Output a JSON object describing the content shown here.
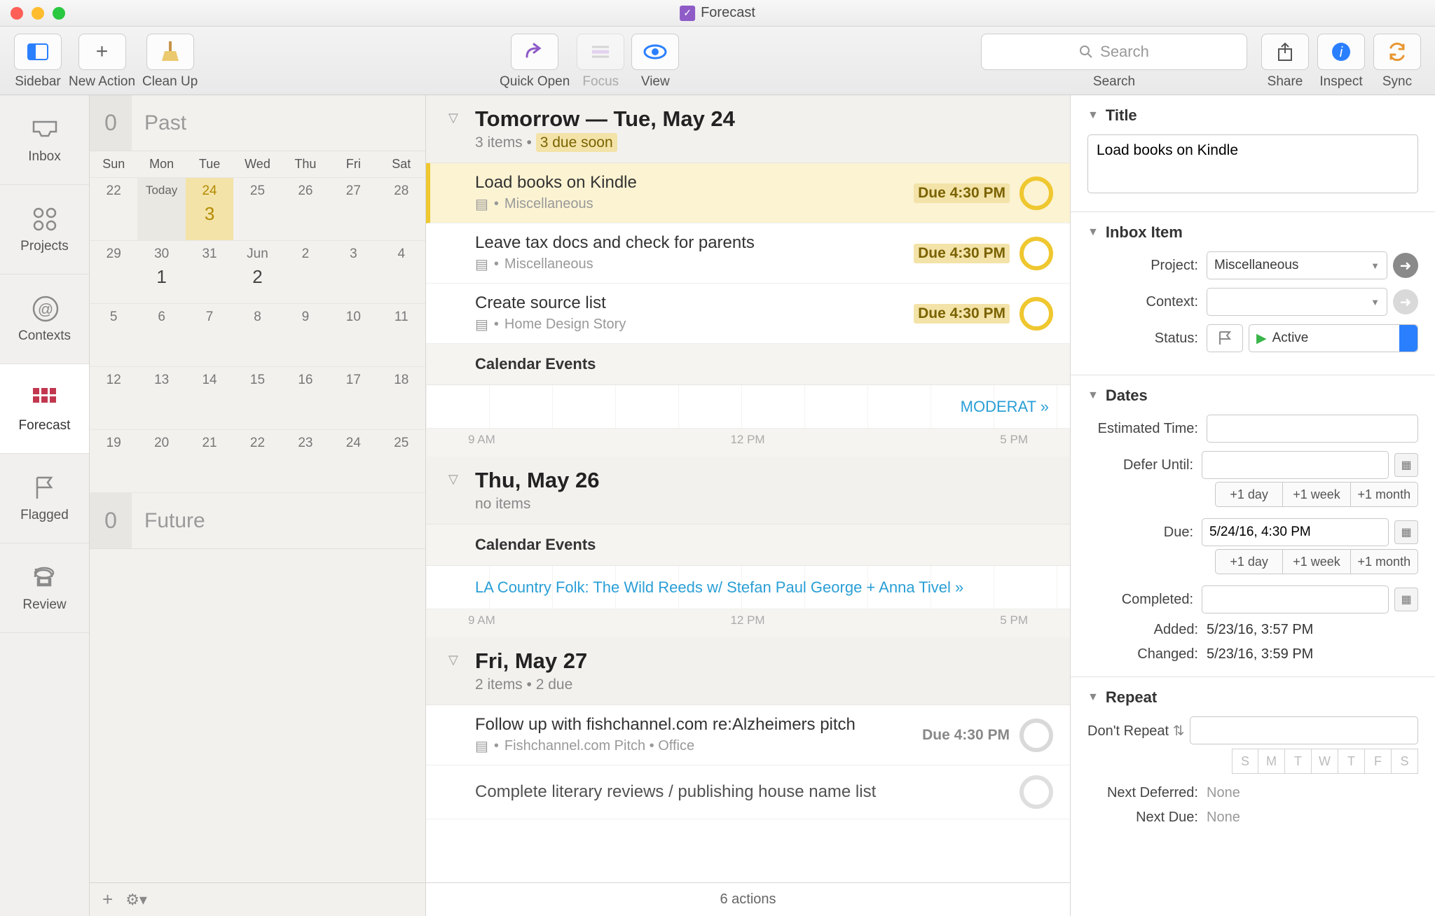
{
  "window": {
    "title": "Forecast"
  },
  "toolbar": {
    "sidebar": "Sidebar",
    "new_action": "New Action",
    "clean_up": "Clean Up",
    "quick_open": "Quick Open",
    "focus": "Focus",
    "view": "View",
    "search_placeholder": "Search",
    "search_label": "Search",
    "share": "Share",
    "inspect": "Inspect",
    "sync": "Sync"
  },
  "sidebar": {
    "items": [
      {
        "label": "Inbox"
      },
      {
        "label": "Projects"
      },
      {
        "label": "Contexts"
      },
      {
        "label": "Forecast"
      },
      {
        "label": "Flagged"
      },
      {
        "label": "Review"
      }
    ]
  },
  "calendar": {
    "past_label": "Past",
    "past_count": "0",
    "future_label": "Future",
    "future_count": "0",
    "dow": [
      "Sun",
      "Mon",
      "Tue",
      "Wed",
      "Thu",
      "Fri",
      "Sat"
    ],
    "rows": [
      [
        "22",
        "Today",
        "24",
        "25",
        "26",
        "27",
        "28"
      ],
      [
        "29",
        "30",
        "31",
        "Jun",
        "2",
        "3",
        "4"
      ],
      [
        "5",
        "6",
        "7",
        "8",
        "9",
        "10",
        "11"
      ],
      [
        "12",
        "13",
        "14",
        "15",
        "16",
        "17",
        "18"
      ],
      [
        "19",
        "20",
        "21",
        "22",
        "23",
        "24",
        "25"
      ]
    ],
    "highlight_sub": "3",
    "today_sub": "",
    "row2_mon_sub": "1",
    "row2_wed_sub": "2"
  },
  "tasks": {
    "section1": {
      "title": "Tomorrow — Tue, May 24",
      "sub_count": "3 items",
      "sub_due": "3 due soon"
    },
    "items1": [
      {
        "title": "Load books on Kindle",
        "project": "Miscellaneous",
        "due": "Due 4:30 PM"
      },
      {
        "title": "Leave tax docs and check for parents",
        "project": "Miscellaneous",
        "due": "Due 4:30 PM"
      },
      {
        "title": "Create source list",
        "project": "Home Design Story",
        "due": "Due 4:30 PM"
      }
    ],
    "cal_events_label": "Calendar Events",
    "timeline_event1": "MODERAT  »",
    "time_labels": [
      "9 AM",
      "12 PM",
      "5 PM"
    ],
    "section2": {
      "title": "Thu, May 26",
      "sub": "no items"
    },
    "timeline_event2": "LA Country Folk: The Wild Reeds w/ Stefan Paul George + Anna Tivel  »",
    "section3": {
      "title": "Fri, May 27",
      "sub": "2 items • 2 due"
    },
    "items3": [
      {
        "title": "Follow up with fishchannel.com re:Alzheimers pitch",
        "project": "Fishchannel.com Pitch • Office",
        "due": "Due 4:30 PM"
      },
      {
        "title": "Complete literary reviews / publishing house name list",
        "project": "",
        "due": ""
      }
    ],
    "footer": "6 actions"
  },
  "inspector": {
    "title_hdr": "Title",
    "title_value": "Load books on Kindle",
    "inbox_hdr": "Inbox Item",
    "project_label": "Project:",
    "project_value": "Miscellaneous",
    "context_label": "Context:",
    "status_label": "Status:",
    "status_value": "Active",
    "dates_hdr": "Dates",
    "est_label": "Estimated Time:",
    "defer_label": "Defer Until:",
    "plus_day": "+1 day",
    "plus_week": "+1 week",
    "plus_month": "+1 month",
    "due_label": "Due:",
    "due_value": "5/24/16, 4:30 PM",
    "completed_label": "Completed:",
    "added_label": "Added:",
    "added_value": "5/23/16, 3:57 PM",
    "changed_label": "Changed:",
    "changed_value": "5/23/16, 3:59 PM",
    "repeat_hdr": "Repeat",
    "repeat_mode": "Don't Repeat",
    "dow_letters": [
      "S",
      "M",
      "T",
      "W",
      "T",
      "F",
      "S"
    ],
    "next_deferred_label": "Next Deferred:",
    "next_deferred_value": "None",
    "next_due_label": "Next Due:",
    "next_due_value": "None"
  }
}
